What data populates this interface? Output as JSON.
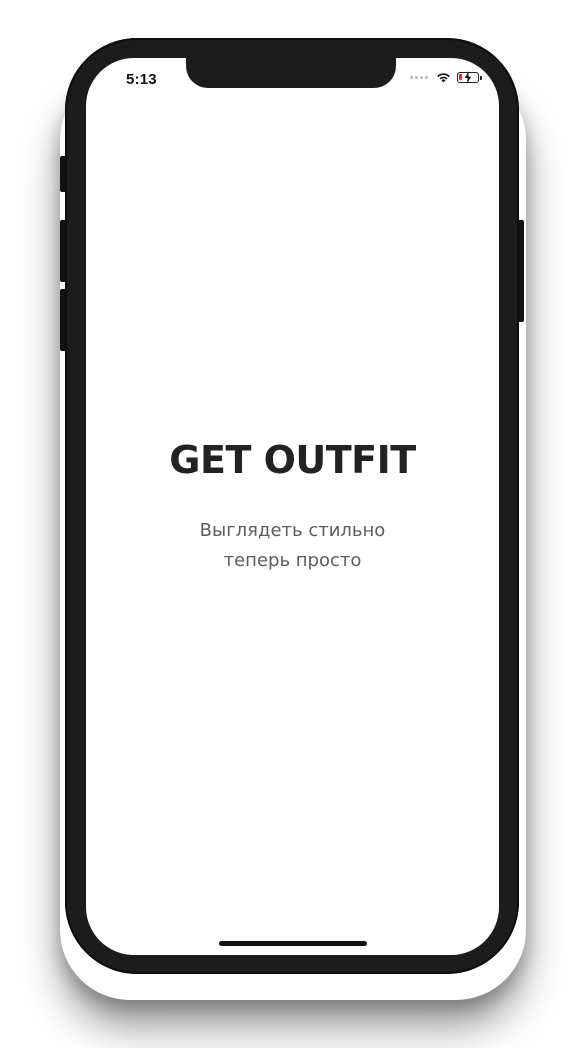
{
  "status_bar": {
    "time": "5:13",
    "battery_level": 0.15,
    "colors": {
      "battery_low": "#e02b2b"
    },
    "icons": [
      "signal-dots-icon",
      "wifi-icon",
      "battery-charging-icon"
    ]
  },
  "splash": {
    "title": "GET OUTFIT",
    "tagline_line1": "Выглядеть стильно",
    "tagline_line2": "теперь просто",
    "colors": {
      "title": "#222222",
      "tagline": "#5a5f5e"
    }
  }
}
